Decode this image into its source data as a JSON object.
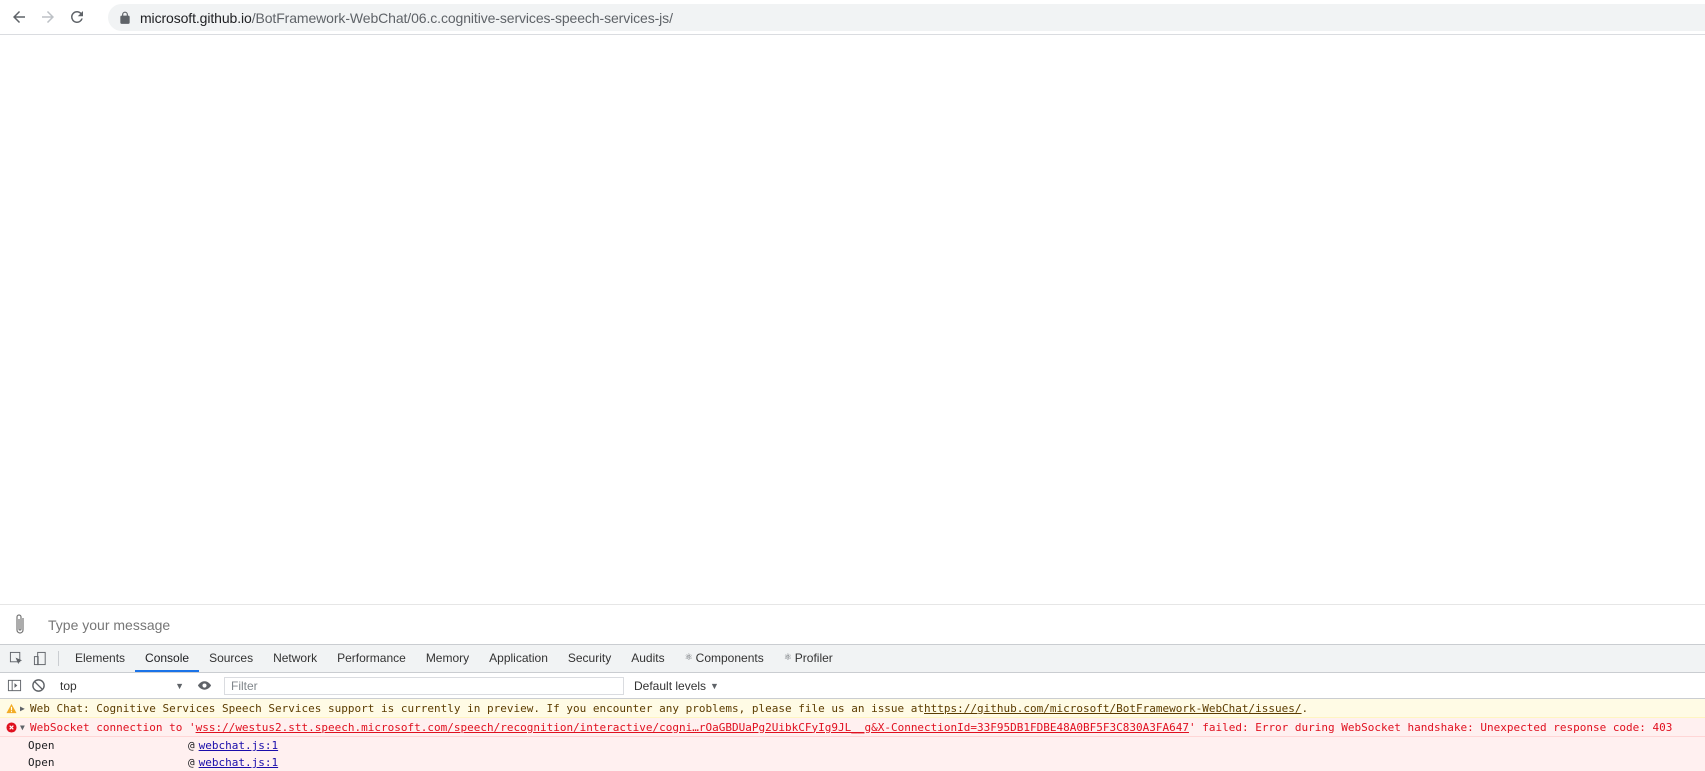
{
  "browser": {
    "url_host": "microsoft.github.io",
    "url_path": "/BotFramework-WebChat/06.c.cognitive-services-speech-services-js/"
  },
  "sendbox": {
    "placeholder": "Type your message"
  },
  "devtools": {
    "tabs": [
      {
        "label": "Elements"
      },
      {
        "label": "Console"
      },
      {
        "label": "Sources"
      },
      {
        "label": "Network"
      },
      {
        "label": "Performance"
      },
      {
        "label": "Memory"
      },
      {
        "label": "Application"
      },
      {
        "label": "Security"
      },
      {
        "label": "Audits"
      },
      {
        "label": "Components"
      },
      {
        "label": "Profiler"
      }
    ],
    "active_tab": "Console",
    "context": "top",
    "filter_placeholder": "Filter",
    "levels_label": "Default levels",
    "messages": {
      "warn_text": "Web Chat: Cognitive Services Speech Services support is currently in preview. If you encounter any problems, please file us an issue at ",
      "warn_link": "https://github.com/microsoft/BotFramework-WebChat/issues/",
      "warn_suffix": ".",
      "error_prefix": "WebSocket connection to '",
      "error_link": "wss://westus2.stt.speech.microsoft.com/speech/recognition/interactive/cogni…rOaGBDUaPg2UibkCFyIg9JL__g&X-ConnectionId=33F95DB1FDBE48A0BF5F3C830A3FA647",
      "error_suffix": "' failed: Error during WebSocket handshake: Unexpected response code: 403",
      "stack": [
        {
          "fn": "Open",
          "at": "@",
          "link": "webchat.js:1"
        },
        {
          "fn": "Open",
          "at": "@",
          "link": "webchat.js:1"
        }
      ]
    }
  },
  "colors": {
    "active_tab_underline": "#1a73e8",
    "warn_bg": "#fffbe5",
    "error_bg": "#fff0f0",
    "error_text": "#e0101f"
  }
}
